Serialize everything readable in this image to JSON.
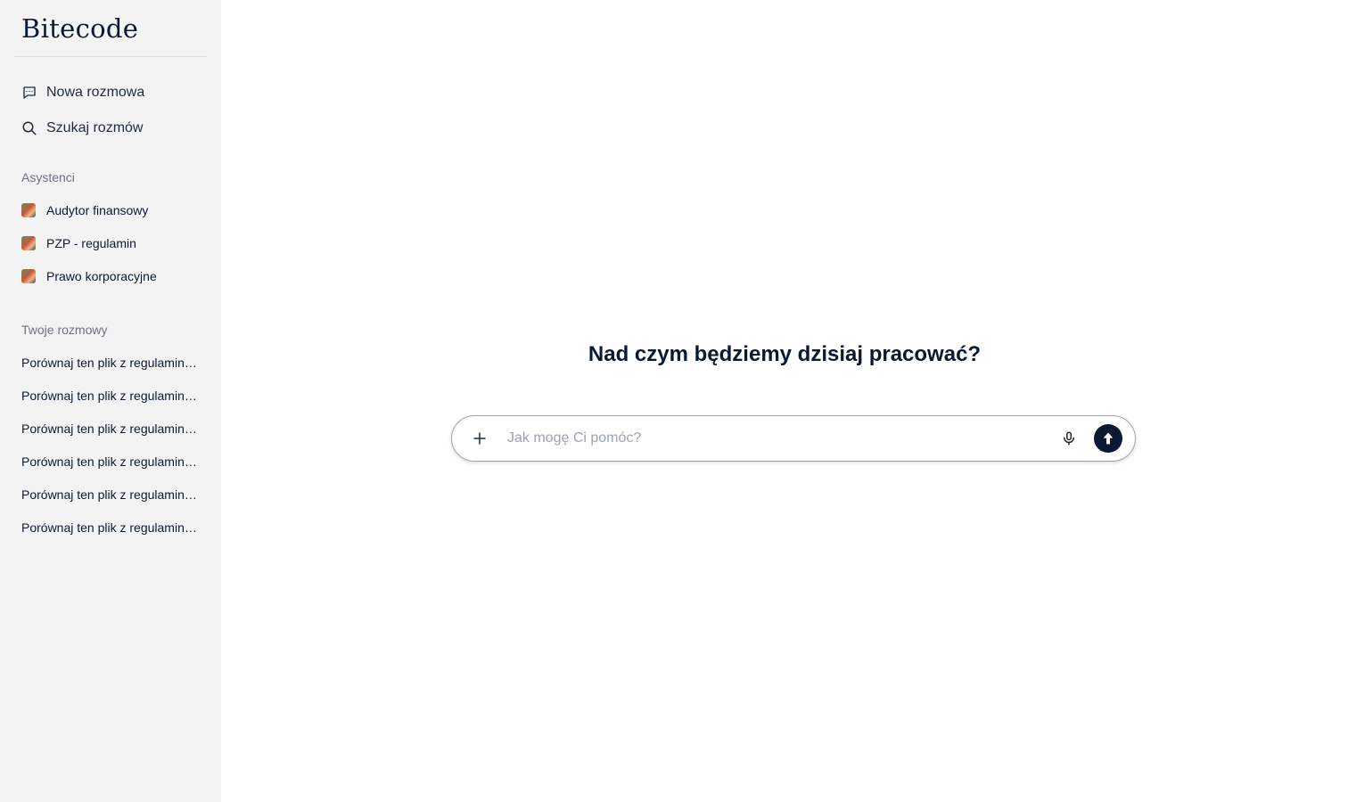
{
  "app": {
    "logo": "Bitecode"
  },
  "nav": {
    "new_chat": "Nowa rozmowa",
    "search_chats": "Szukaj rozmów"
  },
  "assistants": {
    "label": "Asystenci",
    "items": [
      {
        "label": "Audytor finansowy"
      },
      {
        "label": "PZP - regulamin"
      },
      {
        "label": "Prawo korporacyjne"
      }
    ]
  },
  "conversations": {
    "label": "Twoje rozmowy",
    "items": [
      {
        "label": "Porównaj ten plik z regulaminem"
      },
      {
        "label": "Porównaj ten plik z regulaminem"
      },
      {
        "label": "Porównaj ten plik z regulaminem"
      },
      {
        "label": "Porównaj ten plik z regulaminem"
      },
      {
        "label": "Porównaj ten plik z regulaminem"
      },
      {
        "label": "Porównaj ten plik z regulaminem"
      }
    ]
  },
  "main": {
    "headline": "Nad czym będziemy dzisiaj pracować?",
    "composer": {
      "placeholder": "Jak mogę Ci pomóc?",
      "value": ""
    }
  },
  "icons": {
    "new_chat": "chat-bubble-icon",
    "search": "search-icon",
    "add": "plus-icon",
    "mic": "microphone-icon",
    "send": "arrow-up-icon"
  },
  "colors": {
    "accent": "#0b1a33",
    "sidebar_bg": "#f3f3f3"
  }
}
